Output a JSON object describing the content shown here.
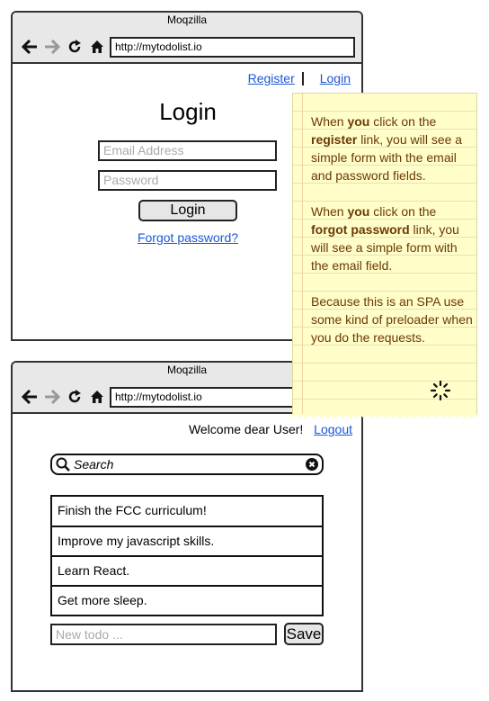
{
  "browser": {
    "title": "Moqzilla",
    "url": "http://mytodolist.io",
    "icons": [
      "back-arrow-icon",
      "forward-arrow-icon",
      "reload-icon",
      "home-icon"
    ]
  },
  "login_page": {
    "links": {
      "register": "Register",
      "login": "Login"
    },
    "title": "Login",
    "email_placeholder": "Email Address",
    "password_placeholder": "Password",
    "login_button": "Login",
    "forgot_link": "Forgot password?"
  },
  "todo_page": {
    "welcome": "Welcome dear User!",
    "logout": "Logout",
    "search_placeholder": "Search",
    "todos": [
      "Finish the FCC curriculum!",
      "Improve my javascript skills.",
      "Learn React.",
      "Get more sleep."
    ],
    "new_todo_placeholder": "New todo ...",
    "save_button": "Save"
  },
  "note": {
    "p1": {
      "a": "When ",
      "b1": "you",
      "c": " click on the ",
      "b2": "register",
      "d": " link, you will see a simple form with the email and password fields."
    },
    "p2": {
      "a": "When ",
      "b1": "you",
      "c": " click on the ",
      "b2": "forgot password",
      "d": " link, you will see a simple form with the email field."
    },
    "p3": "Because this is an SPA use some kind of preloader when you do the requests.",
    "icon": "spinner-icon"
  }
}
